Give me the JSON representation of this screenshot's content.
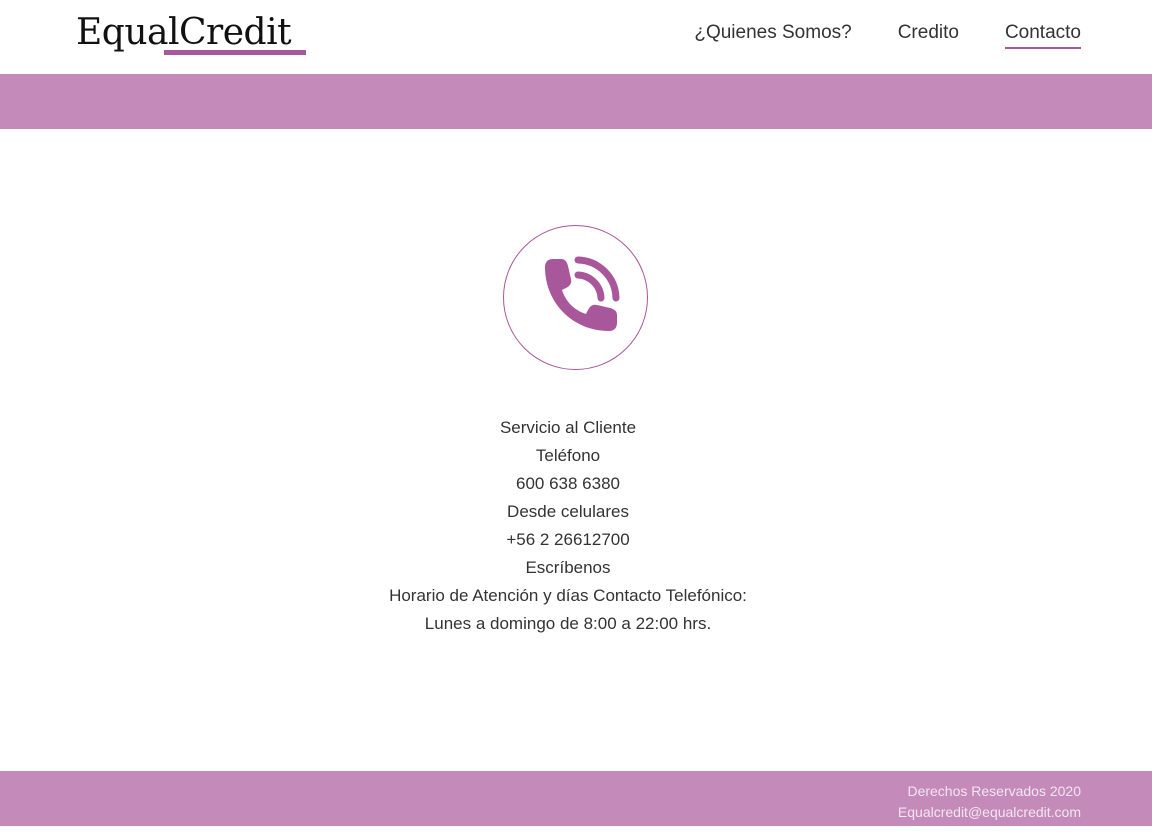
{
  "header": {
    "logo": "EqualCredit",
    "nav": [
      {
        "label": "¿Quienes Somos?"
      },
      {
        "label": "Credito"
      },
      {
        "label": "Contacto"
      }
    ]
  },
  "contact": {
    "icon": "phone-icon",
    "lines": [
      "Servicio al Cliente",
      "Teléfono",
      "600 638 6380",
      "Desde celulares",
      "+56 2 26612700",
      "Escríbenos",
      "Horario de Atención y días Contacto Telefónico:",
      "Lunes a domingo de 8:00 a 22:00 hrs."
    ]
  },
  "footer": {
    "rights": "Derechos Reservados 2020",
    "email": "Equalcredit@equalcredit.com"
  },
  "colors": {
    "accent": "#a8579a",
    "band": "#c48ab9"
  }
}
